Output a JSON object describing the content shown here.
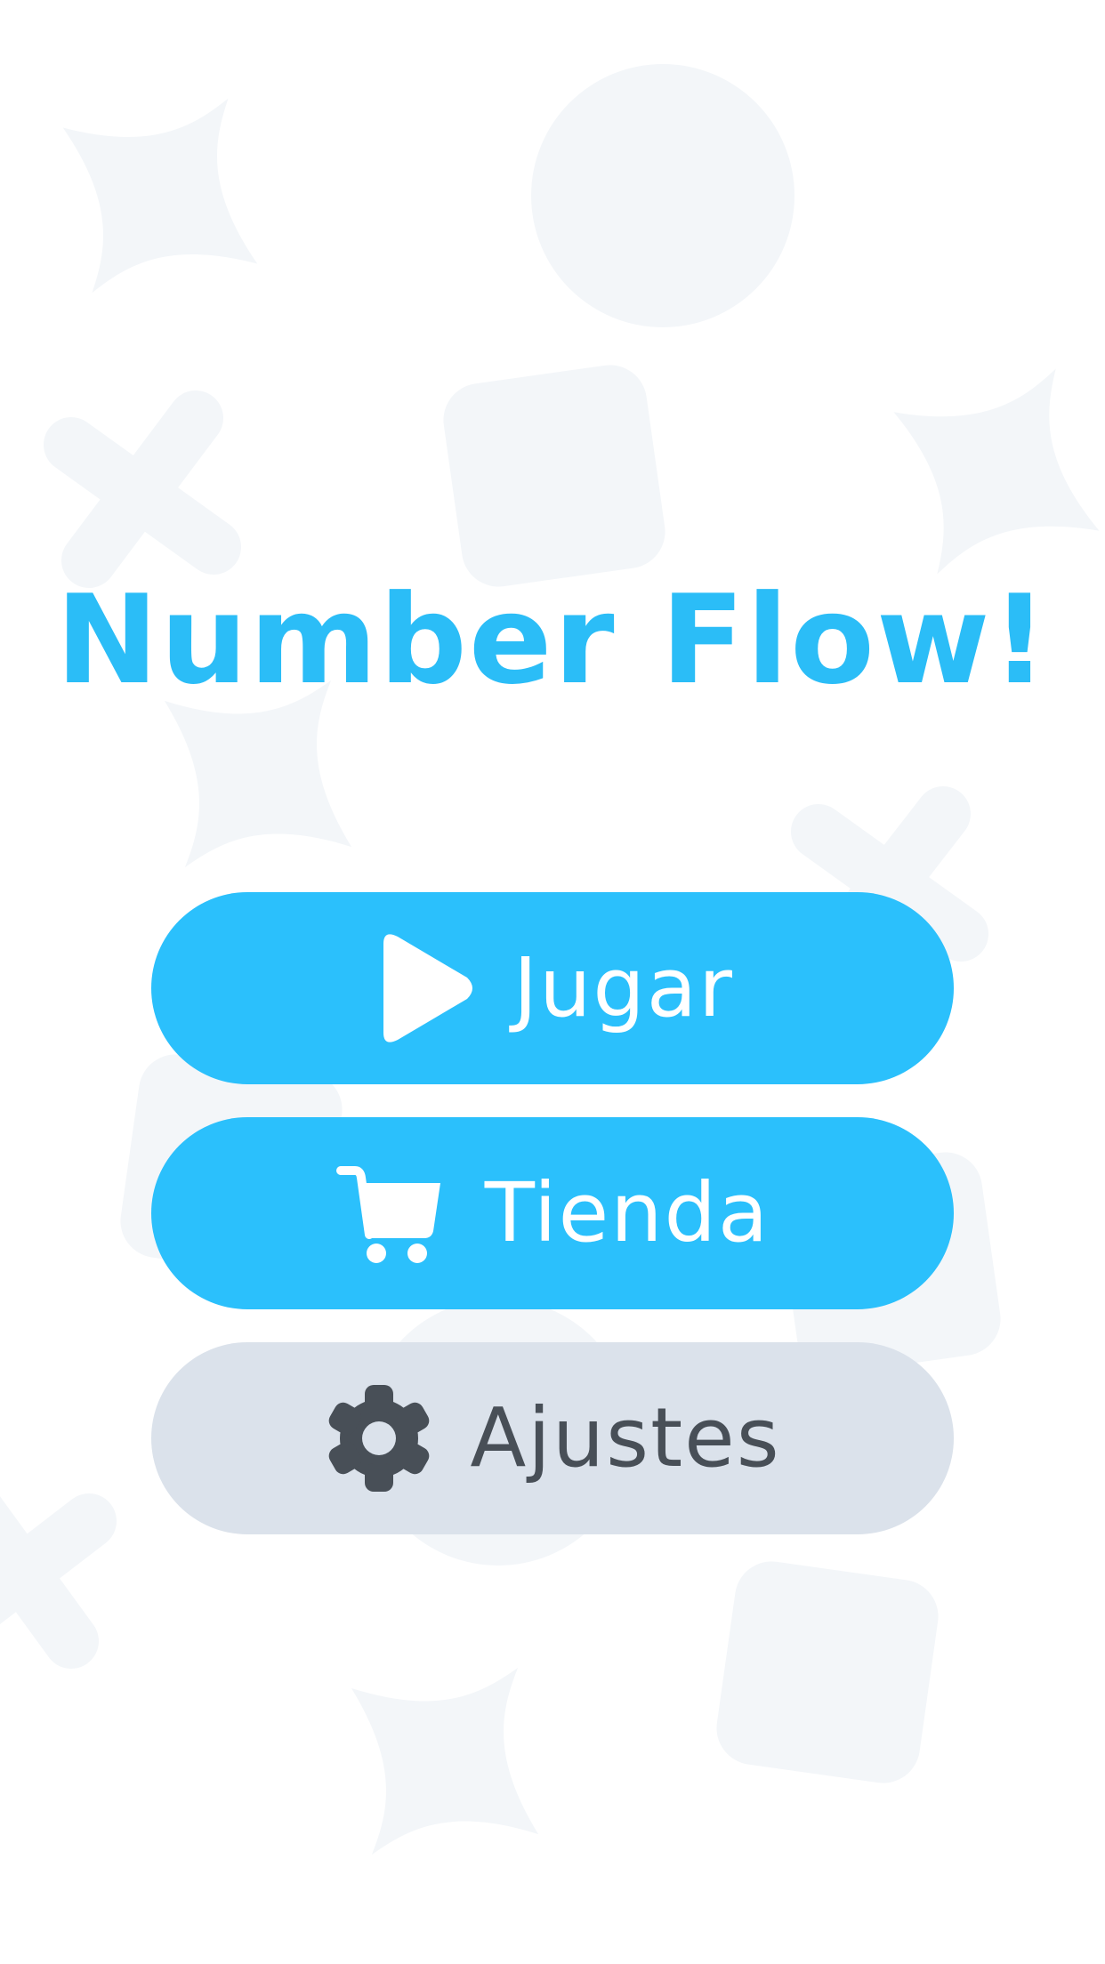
{
  "game": {
    "title": "Number Flow!",
    "accent_color": "#2bbdf7",
    "button_color": "#2bc0fc",
    "secondary_button_color": "#dbe2eb",
    "background_shape_color": "#f3f6f9"
  },
  "menu": {
    "play": {
      "label": "Jugar",
      "icon": "play-icon"
    },
    "shop": {
      "label": "Tienda",
      "icon": "cart-icon"
    },
    "settings": {
      "label": "Ajustes",
      "icon": "gear-icon"
    }
  }
}
